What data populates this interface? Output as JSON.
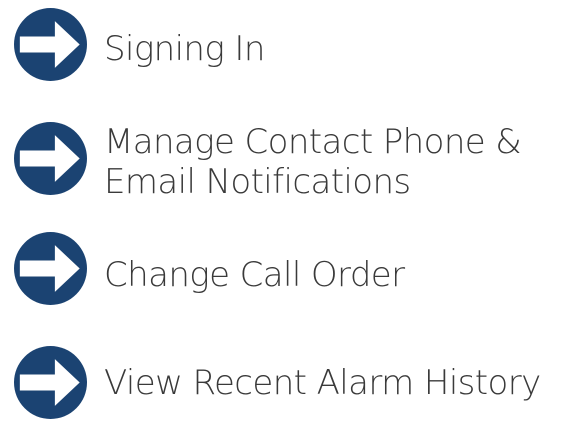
{
  "theme": {
    "icon_color": "#1b4372",
    "text_color": "#3a3a3a",
    "background": "#ffffff"
  },
  "menu": {
    "items": [
      {
        "label_lines": [
          "Signing In"
        ],
        "icon": "arrow-right-circle-icon"
      },
      {
        "label_lines": [
          "Manage Contact Phone &",
          "Email Notifications"
        ],
        "icon": "arrow-right-circle-icon"
      },
      {
        "label_lines": [
          "Change Call Order"
        ],
        "icon": "arrow-right-circle-icon"
      },
      {
        "label_lines": [
          "View Recent Alarm History"
        ],
        "icon": "arrow-right-circle-icon"
      }
    ]
  }
}
